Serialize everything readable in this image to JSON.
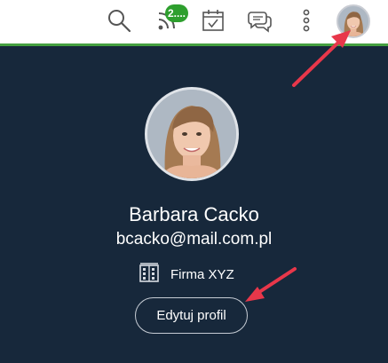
{
  "topbar": {
    "icons": [
      "search-icon",
      "rss-feed-icon",
      "calendar-check-icon",
      "chat-bubbles-icon",
      "more-vertical-icon"
    ],
    "notification_badge": "2...."
  },
  "user": {
    "name": "Barbara Cacko",
    "email": "bcacko@mail.com.pl",
    "company_icon": "building-icon",
    "company": "Firma XYZ"
  },
  "actions": {
    "edit_profile_label": "Edytuj profil"
  },
  "colors": {
    "panel_bg": "#17283b",
    "accent": "#45a040",
    "annotation_arrow": "#e8374a",
    "badge": "#2e9f2e"
  }
}
